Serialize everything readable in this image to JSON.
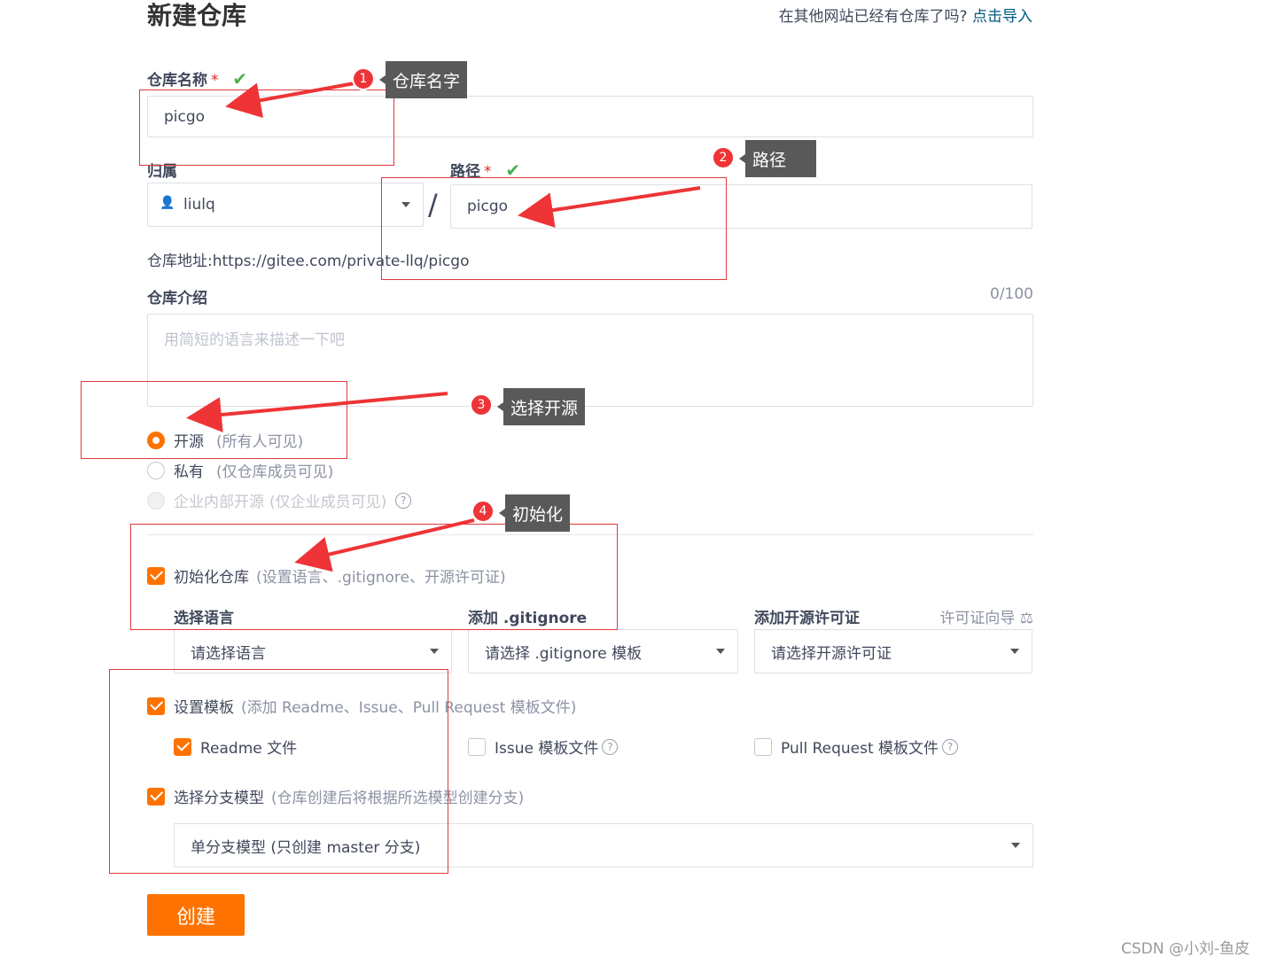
{
  "page": {
    "title": "新建仓库",
    "import_question": "在其他网站已经有仓库了吗?",
    "import_link": "点击导入"
  },
  "repo_name": {
    "label": "仓库名称",
    "required_mark": "*",
    "value": "picgo"
  },
  "owner": {
    "label": "归属",
    "value": "liulq",
    "separator": "/"
  },
  "path": {
    "label": "路径",
    "required_mark": "*",
    "value": "picgo"
  },
  "repo_address": {
    "label": "仓库地址:",
    "value": "https://gitee.com/private-llq/picgo"
  },
  "intro": {
    "label": "仓库介绍",
    "counter": "0/100",
    "placeholder": "用简短的语言来描述一下吧"
  },
  "visibility": {
    "options": [
      {
        "label": "开源",
        "hint": "(所有人可见)",
        "state": "selected"
      },
      {
        "label": "私有",
        "hint": "(仅仓库成员可见)",
        "state": "unselected"
      },
      {
        "label": "企业内部开源",
        "hint": "(仅企业成员可见)",
        "state": "disabled"
      }
    ]
  },
  "init": {
    "label": "初始化仓库",
    "hint": "(设置语言、.gitignore、开源许可证)",
    "checked": true,
    "language": {
      "label": "选择语言",
      "value": "请选择语言"
    },
    "gitignore": {
      "label": "添加 .gitignore",
      "value": "请选择 .gitignore 模板"
    },
    "license": {
      "label": "添加开源许可证",
      "guide": "许可证向导",
      "value": "请选择开源许可证"
    }
  },
  "template": {
    "label": "设置模板",
    "hint": "(添加 Readme、Issue、Pull Request 模板文件)",
    "checked": true,
    "readme": {
      "label": "Readme 文件",
      "checked": true
    },
    "issue": {
      "label": "Issue 模板文件",
      "checked": false
    },
    "pr": {
      "label": "Pull Request 模板文件",
      "checked": false
    }
  },
  "branch": {
    "label": "选择分支模型",
    "hint": "(仓库创建后将根据所选模型创建分支)",
    "checked": true,
    "value": "单分支模型 (只创建 master 分支)"
  },
  "create_button": "创建",
  "annotations": [
    {
      "number": "1",
      "text": "仓库名字"
    },
    {
      "number": "2",
      "text": "路径"
    },
    {
      "number": "3",
      "text": "选择开源"
    },
    {
      "number": "4",
      "text": "初始化"
    }
  ],
  "watermark": "CSDN @小刘-鱼皮",
  "colors": {
    "accent": "#fe7300",
    "annotation_red": "#e0393d",
    "link": "#005980"
  }
}
